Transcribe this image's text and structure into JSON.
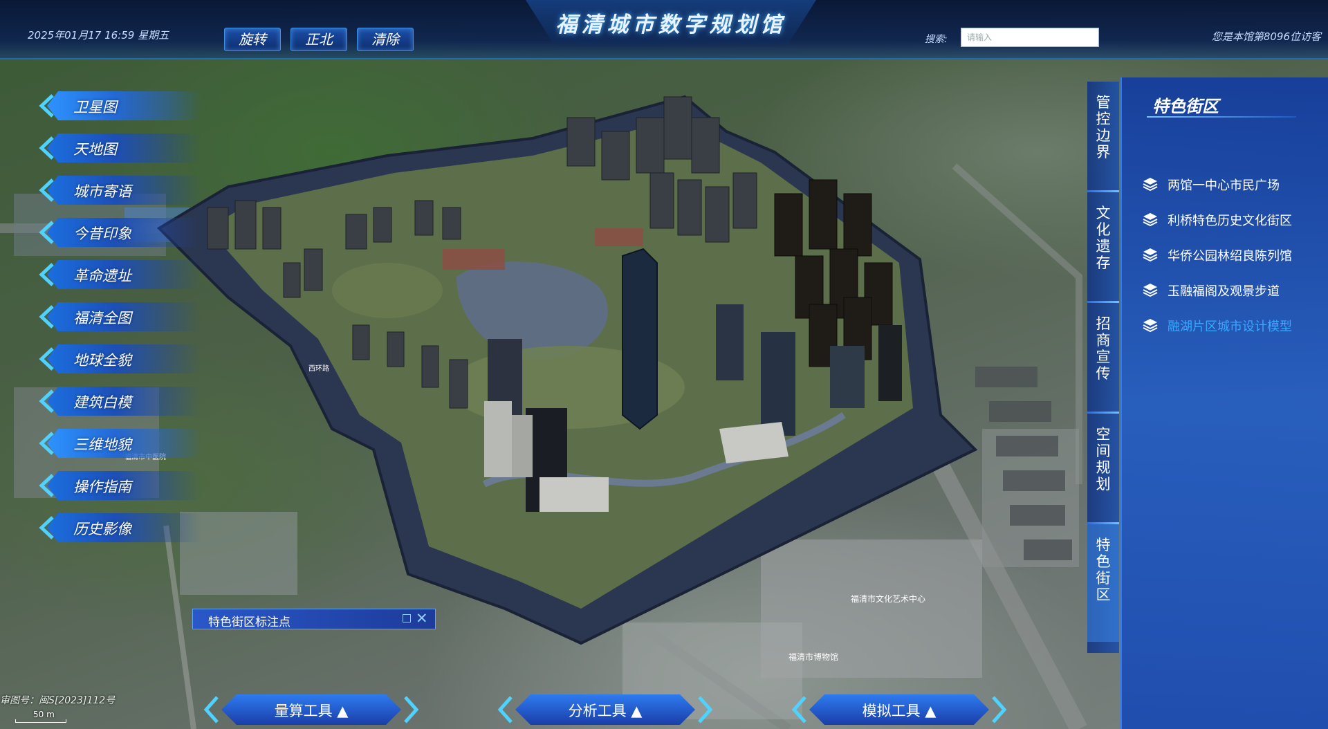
{
  "header": {
    "title": "福清城市数字规划馆",
    "datetime": "2025年01月17 16:59 星期五",
    "buttons": [
      "旋转",
      "正北",
      "清除"
    ],
    "search_label": "搜索:",
    "search_placeholder": "请输入",
    "visitor_text": "您是本馆第8096位访客"
  },
  "left_menu": {
    "items": [
      "卫星图",
      "天地图",
      "城市寄语",
      "今昔印象",
      "革命遗址",
      "福清全图",
      "地球全貌",
      "建筑白模",
      "三维地貌",
      "操作指南",
      "历史影像"
    ],
    "active_index": 0
  },
  "vertical_tabs": {
    "items": [
      "管控边界",
      "文化遗存",
      "招商宣传",
      "空间规划",
      "特色街区"
    ],
    "active_index": 4
  },
  "right_panel": {
    "title": "特色街区",
    "items": [
      "两馆一中心市民广场",
      "利桥特色历史文化街区",
      "华侨公园林绍良陈列馆",
      "玉融福阁及观景步道",
      "融湖片区城市设计模型"
    ],
    "active_index": 4
  },
  "poi_box": {
    "title": "特色街区标注点"
  },
  "bottom_tools": [
    "量算工具 ▲",
    "分析工具 ▲",
    "模拟工具 ▲"
  ],
  "map_footer": {
    "review_no": "审图号：闽S[2023]112号",
    "scale": "50 m"
  },
  "map_labels": [
    "福清市文化艺术中心",
    "福清市博物馆",
    "西环路",
    "福清市中医院"
  ],
  "colors": {
    "accent": "#2d93ff",
    "panel": "#1d5cc8",
    "active_text": "#37a9ff"
  }
}
